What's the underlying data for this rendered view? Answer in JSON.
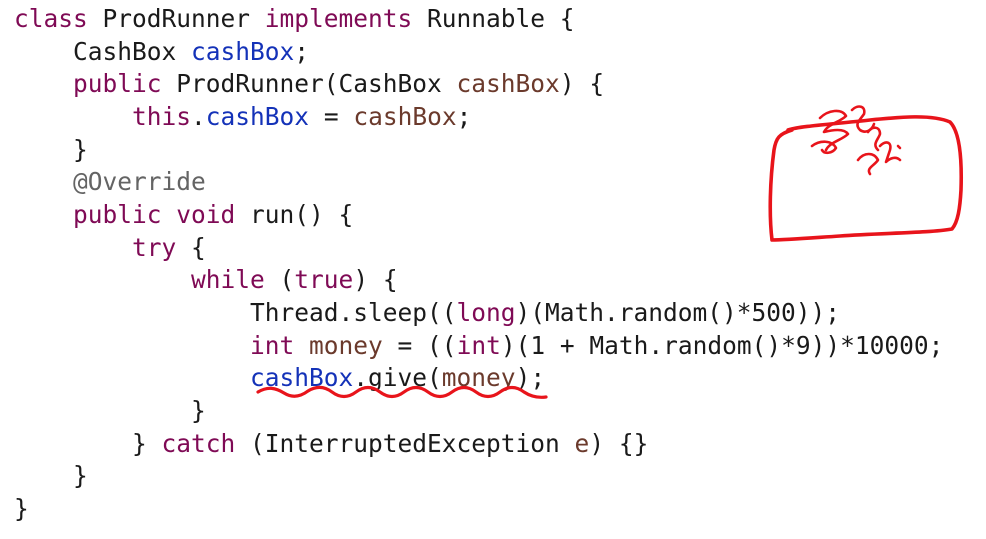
{
  "code_lines": [
    [
      {
        "t": "class ",
        "k": "keyword"
      },
      {
        "t": "ProdRunner ",
        "k": "plain"
      },
      {
        "t": "implements ",
        "k": "keyword"
      },
      {
        "t": "Runnable {",
        "k": "plain"
      }
    ],
    [
      {
        "t": "    CashBox ",
        "k": "plain"
      },
      {
        "t": "cashBox",
        "k": "field"
      },
      {
        "t": ";",
        "k": "plain"
      }
    ],
    [
      {
        "t": "    ",
        "k": "plain"
      },
      {
        "t": "public ",
        "k": "keyword"
      },
      {
        "t": "ProdRunner(CashBox ",
        "k": "plain"
      },
      {
        "t": "cashBox",
        "k": "var"
      },
      {
        "t": ") {",
        "k": "plain"
      }
    ],
    [
      {
        "t": "        ",
        "k": "plain"
      },
      {
        "t": "this",
        "k": "keyword"
      },
      {
        "t": ".",
        "k": "plain"
      },
      {
        "t": "cashBox",
        "k": "field"
      },
      {
        "t": " = ",
        "k": "plain"
      },
      {
        "t": "cashBox",
        "k": "var"
      },
      {
        "t": ";",
        "k": "plain"
      }
    ],
    [
      {
        "t": "    }",
        "k": "plain"
      }
    ],
    [
      {
        "t": "    @Override",
        "k": "annot"
      }
    ],
    [
      {
        "t": "    ",
        "k": "plain"
      },
      {
        "t": "public ",
        "k": "keyword"
      },
      {
        "t": "void ",
        "k": "keyword"
      },
      {
        "t": "run() {",
        "k": "plain"
      }
    ],
    [
      {
        "t": "        ",
        "k": "plain"
      },
      {
        "t": "try",
        "k": "keyword"
      },
      {
        "t": " {",
        "k": "plain"
      }
    ],
    [
      {
        "t": "            ",
        "k": "plain"
      },
      {
        "t": "while",
        "k": "keyword"
      },
      {
        "t": " (",
        "k": "plain"
      },
      {
        "t": "true",
        "k": "keyword"
      },
      {
        "t": ") {",
        "k": "plain"
      }
    ],
    [
      {
        "t": "                Thread.sleep((",
        "k": "plain"
      },
      {
        "t": "long",
        "k": "keyword"
      },
      {
        "t": ")(Math.random()*500));",
        "k": "plain"
      }
    ],
    [
      {
        "t": "                ",
        "k": "plain"
      },
      {
        "t": "int ",
        "k": "keyword"
      },
      {
        "t": "money",
        "k": "var"
      },
      {
        "t": " = ((",
        "k": "plain"
      },
      {
        "t": "int",
        "k": "keyword"
      },
      {
        "t": ")(1 + Math.random()*9))*10000;",
        "k": "plain"
      }
    ],
    [
      {
        "t": "                ",
        "k": "plain"
      },
      {
        "t": "cashBox",
        "k": "field"
      },
      {
        "t": ".give(",
        "k": "plain"
      },
      {
        "t": "money",
        "k": "var"
      },
      {
        "t": ");",
        "k": "plain"
      }
    ],
    [
      {
        "t": "            }",
        "k": "plain"
      }
    ],
    [
      {
        "t": "        } ",
        "k": "plain"
      },
      {
        "t": "catch",
        "k": "keyword"
      },
      {
        "t": " (InterruptedException ",
        "k": "plain"
      },
      {
        "t": "e",
        "k": "var"
      },
      {
        "t": ") {}",
        "k": "plain"
      }
    ],
    [
      {
        "t": "    }",
        "k": "plain"
      }
    ],
    [
      {
        "t": "}",
        "k": "plain"
      }
    ]
  ],
  "colors": {
    "keyword": "#7f0a55",
    "field": "#1432b8",
    "var": "#6b3a2c",
    "annot": "#646464",
    "plain": "#1a1a1a",
    "ink": "#e8141b"
  },
  "annotations": {
    "underline_target": "cashBox.give(money);",
    "box_scribble": "handwritten red scribble inside a hand-drawn box"
  }
}
